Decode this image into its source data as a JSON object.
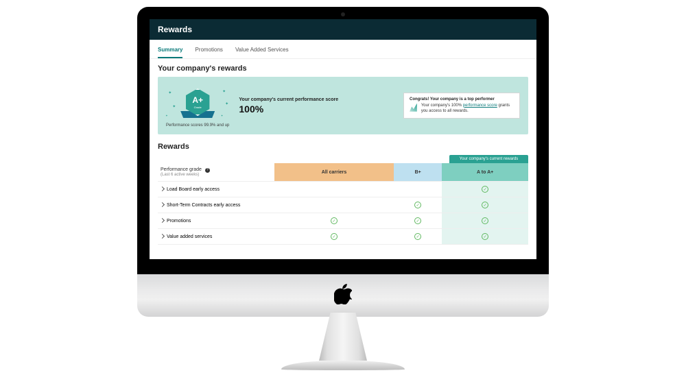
{
  "header": {
    "title": "Rewards"
  },
  "tabs": [
    {
      "label": "Summary",
      "active": true
    },
    {
      "label": "Promotions",
      "active": false
    },
    {
      "label": "Value Added Services",
      "active": false
    }
  ],
  "hero": {
    "section_title": "Your company's rewards",
    "badge_grade": "A+",
    "badge_label": "Grade",
    "badge_caption": "Performance scores 99.9% and up",
    "score_label": "Your company's current performance score",
    "score_value": "100%",
    "callout_title": "Congrats! Your company is a top performer",
    "callout_text_prefix": "Your company's 100% ",
    "callout_link": "performance score",
    "callout_text_suffix": " grants you access to all rewards."
  },
  "rewards": {
    "title": "Rewards",
    "current_tier_badge": "Your company's current rewards",
    "grade_header": "Performance grade",
    "grade_sub": "(Last 6 active weeks)",
    "columns": {
      "all": "All carriers",
      "bp": "B+",
      "ap_from": "A",
      "ap_join": " to ",
      "ap_to": "A+"
    },
    "rows": [
      {
        "label": "Load Board early access",
        "all": false,
        "bp": false,
        "ap": true
      },
      {
        "label": "Short-Term Contracts early access",
        "all": false,
        "bp": true,
        "ap": true
      },
      {
        "label": "Promotions",
        "all": true,
        "bp": true,
        "ap": true
      },
      {
        "label": "Value added services",
        "all": true,
        "bp": true,
        "ap": true
      }
    ]
  }
}
